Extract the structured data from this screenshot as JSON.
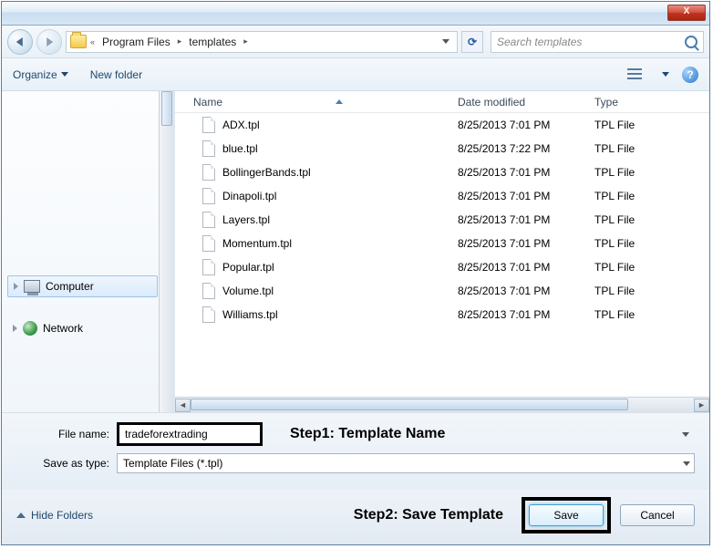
{
  "titlebar": {
    "close": "X"
  },
  "nav": {
    "crumb_sep": "«",
    "crumb1": "Program Files",
    "crumb2": "templates",
    "arrow": "▸",
    "refresh": "↻",
    "search_placeholder": "Search templates"
  },
  "toolbar": {
    "organize": "Organize",
    "new_folder": "New folder",
    "help": "?"
  },
  "tree": {
    "computer": "Computer",
    "network": "Network"
  },
  "columns": {
    "name": "Name",
    "date": "Date modified",
    "type": "Type"
  },
  "files": [
    {
      "name": "ADX.tpl",
      "date": "8/25/2013 7:01 PM",
      "type": "TPL File"
    },
    {
      "name": "blue.tpl",
      "date": "8/25/2013 7:22 PM",
      "type": "TPL File"
    },
    {
      "name": "BollingerBands.tpl",
      "date": "8/25/2013 7:01 PM",
      "type": "TPL File"
    },
    {
      "name": "Dinapoli.tpl",
      "date": "8/25/2013 7:01 PM",
      "type": "TPL File"
    },
    {
      "name": "Layers.tpl",
      "date": "8/25/2013 7:01 PM",
      "type": "TPL File"
    },
    {
      "name": "Momentum.tpl",
      "date": "8/25/2013 7:01 PM",
      "type": "TPL File"
    },
    {
      "name": "Popular.tpl",
      "date": "8/25/2013 7:01 PM",
      "type": "TPL File"
    },
    {
      "name": "Volume.tpl",
      "date": "8/25/2013 7:01 PM",
      "type": "TPL File"
    },
    {
      "name": "Williams.tpl",
      "date": "8/25/2013 7:01 PM",
      "type": "TPL File"
    }
  ],
  "bottom": {
    "filename_label": "File name:",
    "filename_value": "tradeforextrading",
    "saveas_label": "Save as type:",
    "saveas_value": "Template Files (*.tpl)",
    "step1": "Step1: Template Name"
  },
  "footer": {
    "hide": "Hide Folders",
    "step2": "Step2: Save Template",
    "save": "Save",
    "cancel": "Cancel"
  }
}
